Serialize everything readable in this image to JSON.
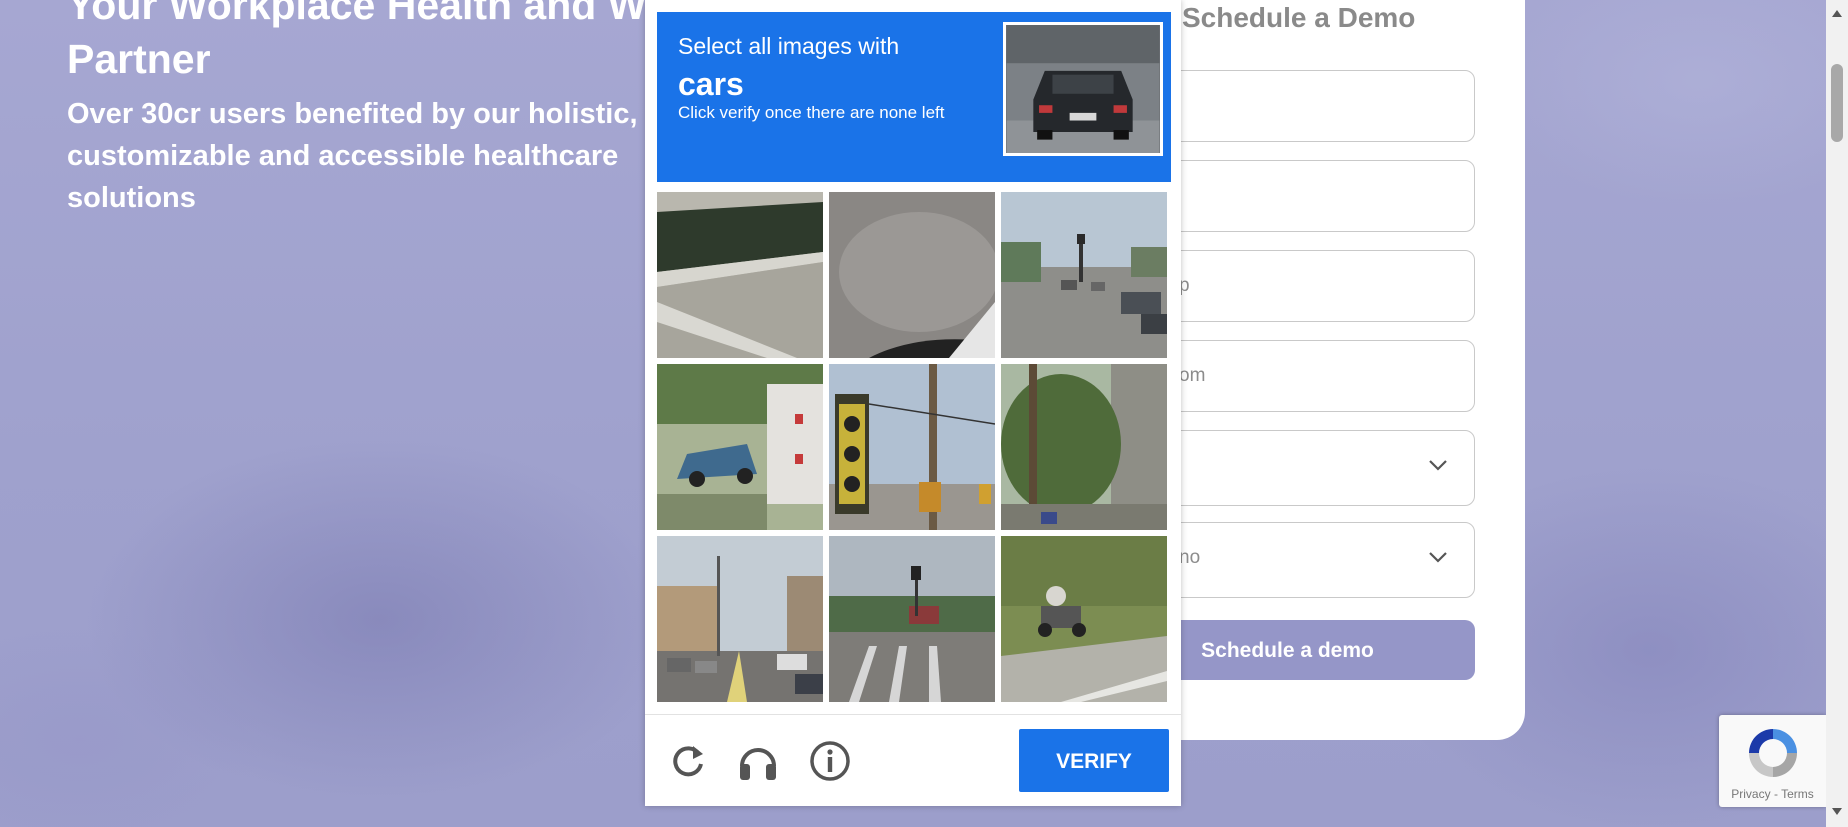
{
  "hero": {
    "title": "Your Workplace Health and Wellness Partner",
    "subtitle": "Over 30cr users benefited by our holistic,\ncustomizable and accessible healthcare solutions"
  },
  "form": {
    "heading": "Schedule a Demo",
    "fields": [
      {
        "placeholder": ""
      },
      {
        "placeholder": ""
      },
      {
        "placeholder": "p"
      },
      {
        "placeholder": "om"
      },
      {
        "placeholder": ""
      },
      {
        "placeholder": "no"
      }
    ],
    "submit_label": "Schedule a demo"
  },
  "captcha": {
    "line1": "Select all images with",
    "target": "cars",
    "line3": "Click verify once there are none left",
    "verify_label": "VERIFY",
    "icons": [
      "reload-icon",
      "headphones-icon",
      "info-icon"
    ]
  },
  "badge": {
    "privacy": "Privacy",
    "separator": " - ",
    "terms": "Terms"
  },
  "colors": {
    "accent": "#1a73e8",
    "demo_button": "#9596c8",
    "background": "#a4a5cf"
  }
}
